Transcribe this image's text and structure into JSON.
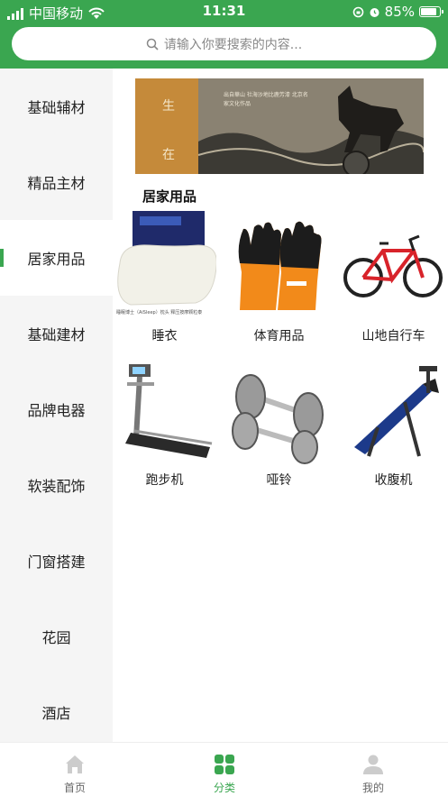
{
  "status": {
    "carrier": "中国移动",
    "time": "11:31",
    "battery": "85%",
    "battery_level": 0.85
  },
  "search": {
    "placeholder": "请输入你要搜索的内容..."
  },
  "sidebar": {
    "items": [
      {
        "label": "基础辅材"
      },
      {
        "label": "精品主材"
      },
      {
        "label": "居家用品"
      },
      {
        "label": "基础建材"
      },
      {
        "label": "品牌电器"
      },
      {
        "label": "软装配饰"
      },
      {
        "label": "门窗搭建"
      },
      {
        "label": "花园"
      },
      {
        "label": "酒店"
      }
    ],
    "active_index": 2
  },
  "banner": {
    "text_left": "生 在",
    "text_right": "出自華山 社海沙地比鹿芳漆 北京名家文化作品"
  },
  "section": {
    "title": "居家用品"
  },
  "products": [
    {
      "label": "睡衣",
      "image_text": "睡眠博士（AiSleep）枕头 释压按摩颗粒泰"
    },
    {
      "label": "体育用品"
    },
    {
      "label": "山地自行车"
    },
    {
      "label": "跑步机"
    },
    {
      "label": "哑铃"
    },
    {
      "label": "收腹机"
    }
  ],
  "tabbar": {
    "tabs": [
      {
        "label": "首页"
      },
      {
        "label": "分类"
      },
      {
        "label": "我的"
      }
    ],
    "active_index": 1
  },
  "colors": {
    "brand": "#3aa650",
    "sidebar_bg": "#f5f5f5"
  }
}
